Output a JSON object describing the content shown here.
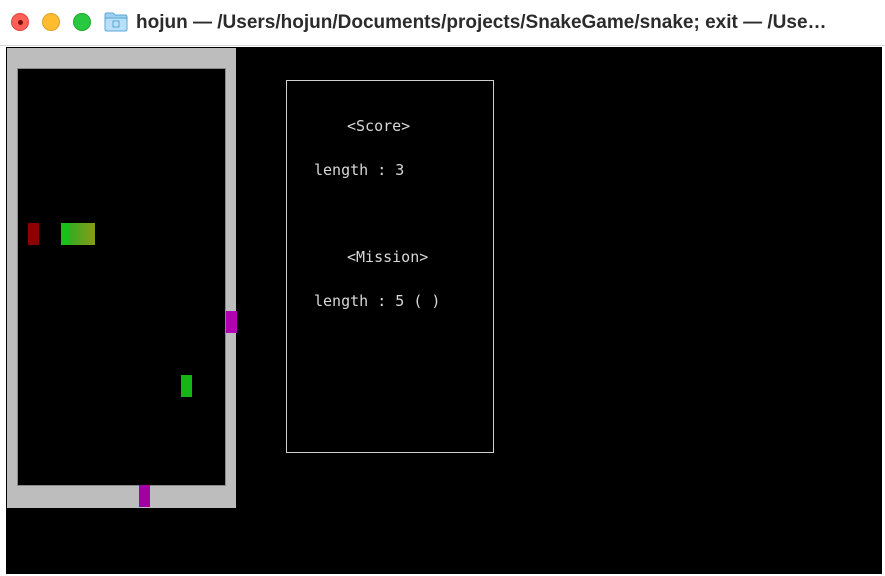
{
  "window": {
    "title": "hojun — /Users/hojun/Documents/projects/SnakeGame/snake; exit — /Use…",
    "folder_icon": "folder-icon",
    "traffic_lights": [
      "close-button",
      "minimize-button",
      "zoom-button"
    ]
  },
  "colors": {
    "wall": "#bdbdbd",
    "snake": "#1fb51f",
    "food_red": "#8c0000",
    "food_green": "#15b515",
    "gate": "#b100b1"
  },
  "panel": {
    "score_heading": "<Score>",
    "score_line": "length : 3",
    "mission_heading": "<Mission>",
    "mission_line": "length : 5 ( )"
  }
}
